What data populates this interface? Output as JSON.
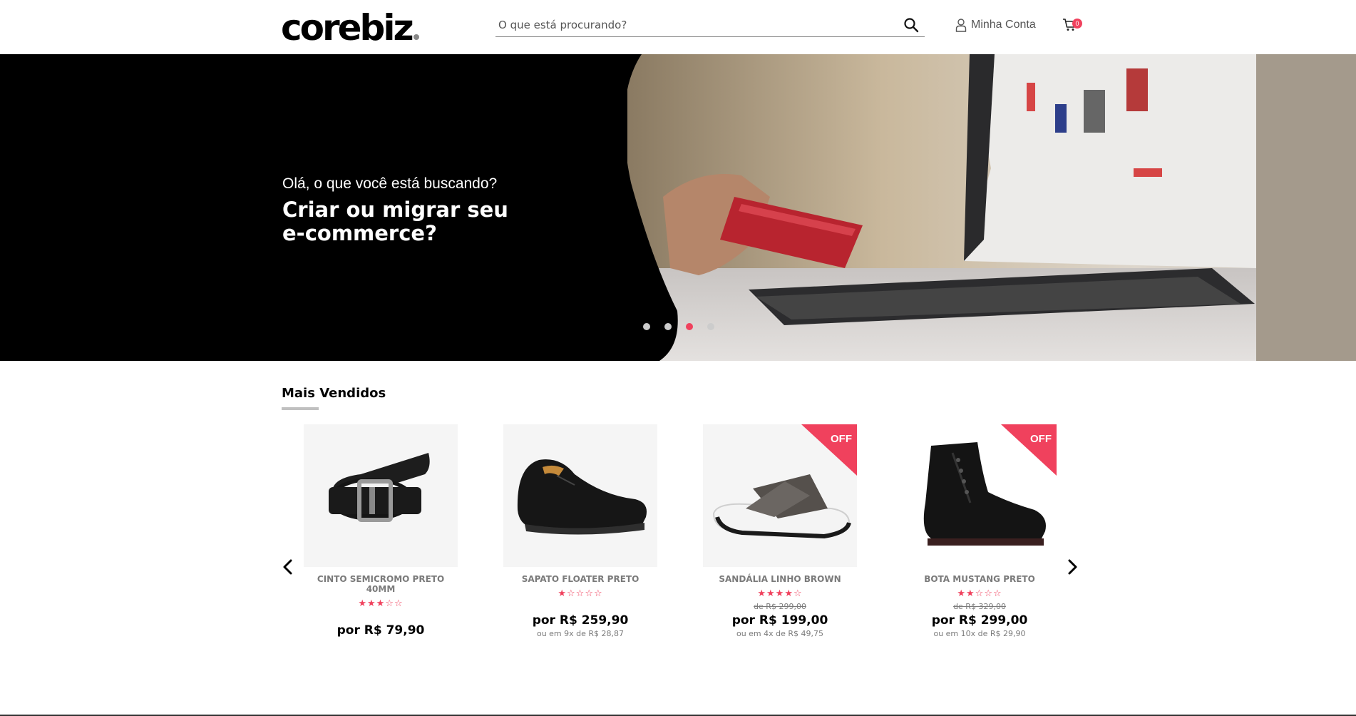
{
  "header": {
    "logo": "corebiz",
    "search_placeholder": "O que está procurando?",
    "account_label": "Minha Conta",
    "cart_count": "0",
    "accent": "#f0415d"
  },
  "banner": {
    "subtitle": "Olá, o que você está buscando?",
    "title": "Criar ou migrar seu e-commerce?",
    "slides": 4,
    "active_slide": 3
  },
  "section": {
    "title": "Mais Vendidos"
  },
  "products": [
    {
      "name": "CINTO SEMICROMO PRETO 40MM",
      "rating": 3,
      "old_price": "",
      "price": "por R$ 79,90",
      "installments": "",
      "off": false,
      "off_label": ""
    },
    {
      "name": "SAPATO FLOATER PRETO",
      "rating": 1,
      "old_price": "",
      "price": "por R$ 259,90",
      "installments": "ou em 9x de R$ 28,87",
      "off": false,
      "off_label": ""
    },
    {
      "name": "SANDÁLIA LINHO BROWN",
      "rating": 4,
      "old_price": "de R$ 299,00",
      "price": "por R$ 199,00",
      "installments": "ou em 4x de R$ 49,75",
      "off": true,
      "off_label": "OFF"
    },
    {
      "name": "BOTA MUSTANG PRETO",
      "rating": 2,
      "old_price": "de R$ 329,00",
      "price": "por R$ 299,00",
      "installments": "ou em 10x de R$ 29,90",
      "off": true,
      "off_label": "OFF"
    }
  ]
}
